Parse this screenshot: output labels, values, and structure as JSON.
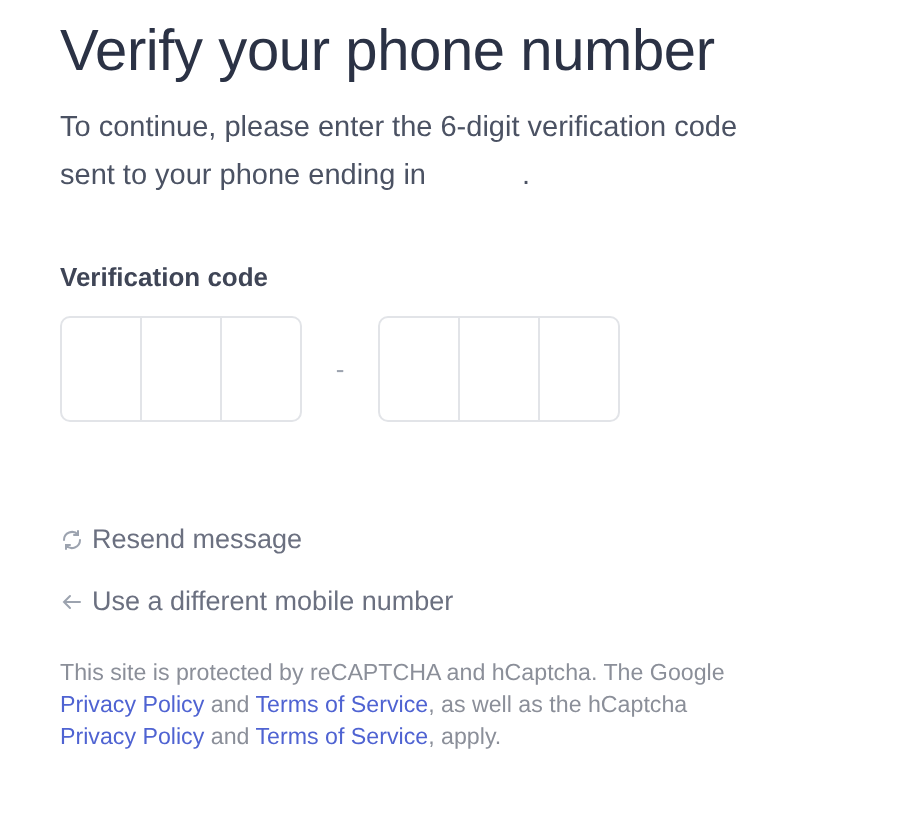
{
  "title": "Verify your phone number",
  "subtitle": {
    "text": "To continue, please enter the 6-digit verification code sent to your phone ending in",
    "end": "."
  },
  "code_label": "Verification code",
  "code_groups": [
    {
      "cells": [
        {
          "kind": "digit"
        },
        {
          "kind": "digit"
        },
        {
          "kind": "digit"
        }
      ]
    },
    {
      "cells": [
        {
          "kind": "digit"
        },
        {
          "kind": "digit"
        },
        {
          "kind": "digit"
        }
      ]
    }
  ],
  "code_separator": "-",
  "links": [
    {
      "kind": "resend",
      "label": "Resend message"
    },
    {
      "kind": "back",
      "label": "Use a different mobile number"
    }
  ],
  "footer": [
    {
      "kind": "text",
      "text": "This site is protected by reCAPTCHA and hCaptcha. The Google "
    },
    {
      "kind": "link",
      "text": "Privacy Policy"
    },
    {
      "kind": "text",
      "text": " and "
    },
    {
      "kind": "link",
      "text": "Terms of Service"
    },
    {
      "kind": "text",
      "text": ", as well as the hCaptcha "
    },
    {
      "kind": "link",
      "text": "Privacy Policy"
    },
    {
      "kind": "text",
      "text": " and "
    },
    {
      "kind": "link",
      "text": "Terms of Service"
    },
    {
      "kind": "text",
      "text": ", apply."
    }
  ]
}
